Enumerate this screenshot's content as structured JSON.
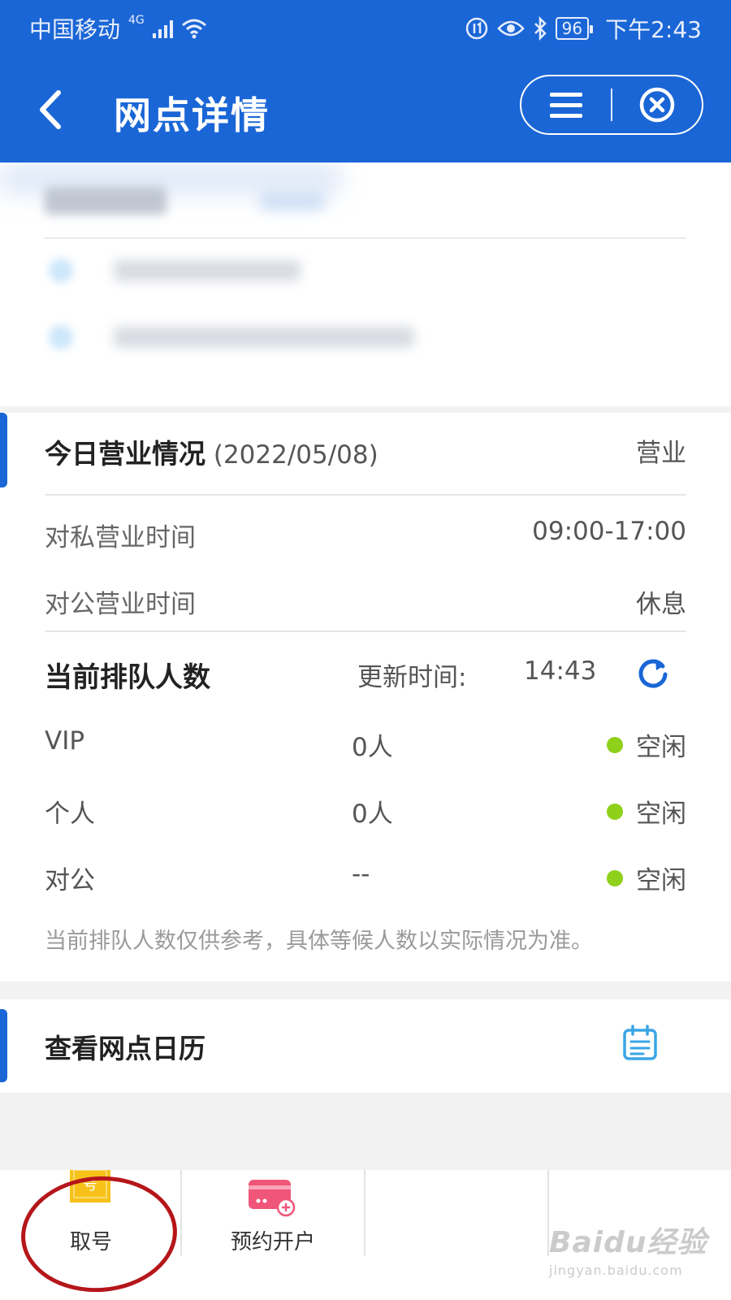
{
  "status_bar": {
    "carrier": "中国移动",
    "network": "4G",
    "battery": "96",
    "time": "下午2:43"
  },
  "header": {
    "title": "网点详情"
  },
  "business_today": {
    "title": "今日营业情况",
    "date": "(2022/05/08)",
    "status": "营业",
    "private_hours_label": "对私营业时间",
    "private_hours_value": "09:00-17:00",
    "corporate_hours_label": "对公营业时间",
    "corporate_hours_value": "休息"
  },
  "queue": {
    "title": "当前排队人数",
    "update_label": "更新时间:",
    "update_time": "14:43",
    "rows": [
      {
        "name": "VIP",
        "count": "0人",
        "status": "空闲"
      },
      {
        "name": "个人",
        "count": "0人",
        "status": "空闲"
      },
      {
        "name": "对公",
        "count": "--",
        "status": "空闲"
      }
    ],
    "status_color": "#8fd01a",
    "note": "当前排队人数仅供参考，具体等候人数以实际情况为准。"
  },
  "calendar": {
    "title": "查看网点日历"
  },
  "bottom_tabs": [
    {
      "label": "取号",
      "icon": "ticket-icon",
      "icon_glyph": "号"
    },
    {
      "label": "预约开户",
      "icon": "card-add-icon"
    }
  ],
  "watermark": {
    "brand": "Baidu经验",
    "url": "jingyan.baidu.com"
  },
  "colors": {
    "brand_blue": "#1a66d6",
    "annotation_red": "#b5161a",
    "ticket_yellow": "#f6c21a",
    "card_pink": "#f0557a"
  }
}
